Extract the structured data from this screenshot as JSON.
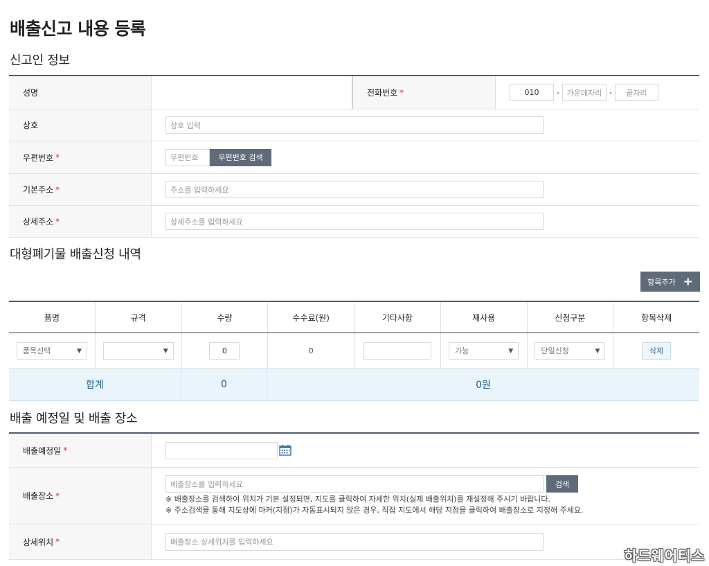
{
  "page": {
    "title": "배출신고 내용 등록"
  },
  "sections": {
    "applicant": "신고인 정보",
    "waste": "대형폐기물 배출신청 내역",
    "schedule": "배출 예정일 및 배출 장소"
  },
  "applicant": {
    "name_label": "성명",
    "phone_label": "전화번호",
    "phone_first": "010",
    "phone_middle_placeholder": "가운데자리",
    "phone_last_placeholder": "끝자리",
    "phone_sep": "-",
    "business_label": "상호",
    "business_placeholder": "상호 입력",
    "zip_label": "우편번호",
    "zip_placeholder": "우편번호",
    "zip_search_label": "우편번호 검색",
    "address_label": "기본주소",
    "address_placeholder": "주소를 입력하세요",
    "detail_label": "상세주소",
    "detail_placeholder": "상세주소를 입력하세요",
    "required_mark": "*"
  },
  "waste": {
    "add_item_label": "항목추가",
    "add_icon": "+",
    "columns": [
      "품명",
      "규격",
      "수량",
      "수수료(원)",
      "기타사항",
      "재사용",
      "신청구분",
      "항목삭제"
    ],
    "row": {
      "item_select": "품목선택",
      "spec_select": "",
      "quantity": "0",
      "fee": "0",
      "note": "",
      "reuse_select": "가능",
      "type_select": "단일신청",
      "delete_label": "삭제"
    },
    "total": {
      "label": "합계",
      "quantity": "0",
      "fee": "0원"
    }
  },
  "schedule": {
    "date_label": "배출예정일",
    "place_label": "배출장소",
    "place_placeholder": "배출장소를 입력하세요",
    "search_label": "검색",
    "note1": "※ 배출장소를 검색하여 위치가 기본 설정되면, 지도를 클릭하여 자세한 위치(실제 배출위치)를 재설정해 주시기 바랍니다.",
    "note2": "※ 주소검색을 통해 지도상에 마커(지점)가 자동표시되지 않은 경우, 직접 지도에서 해당 지점을 클릭하여 배출장소로 지정해 주세요.",
    "detail_label": "상세위치",
    "detail_placeholder": "배출장소 상세위치를 입력하세요"
  },
  "watermark": "하드웨어티스"
}
